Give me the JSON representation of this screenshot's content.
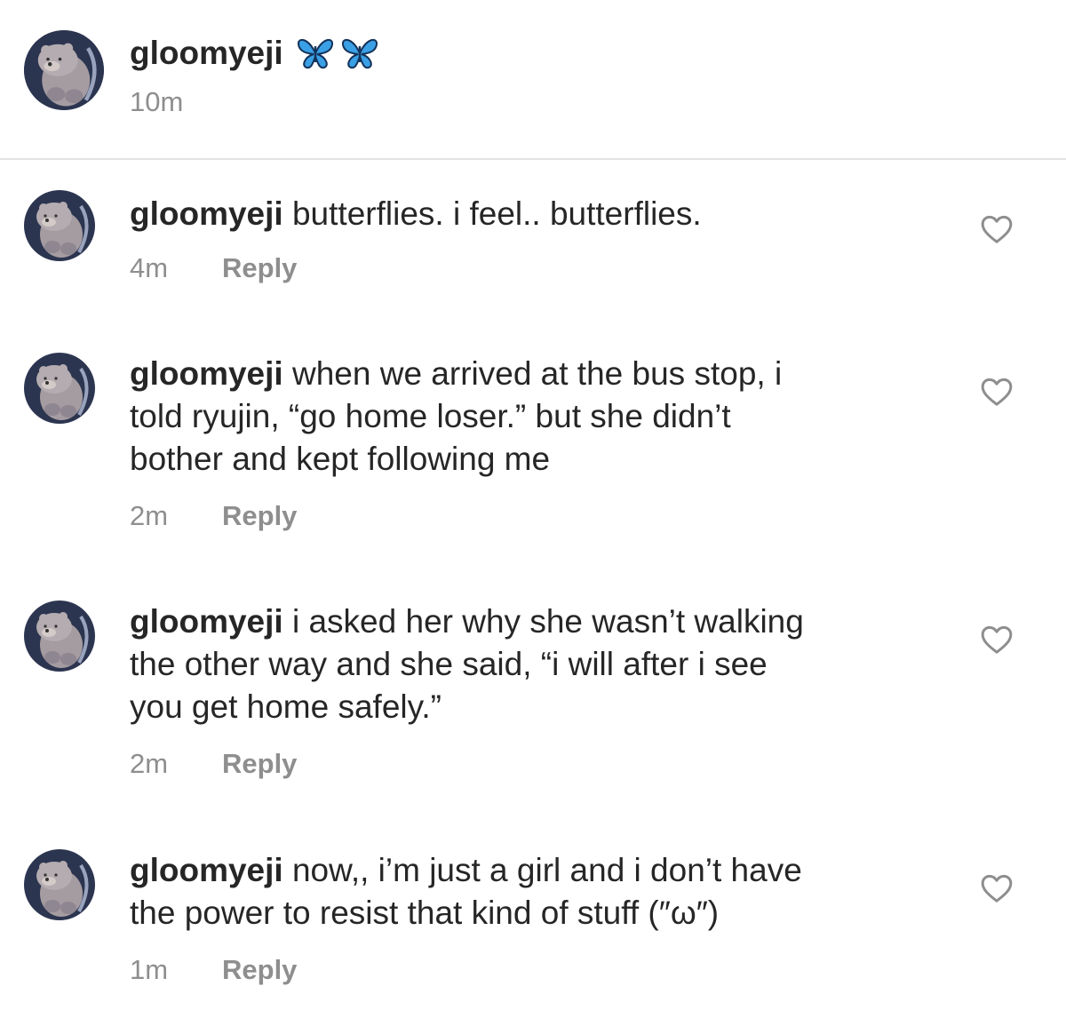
{
  "post": {
    "username": "gloomyeji",
    "emoji": [
      "butterfly",
      "butterfly"
    ],
    "time": "10m"
  },
  "comments": [
    {
      "username": "gloomyeji",
      "text": "butterflies. i feel.. butterflies.",
      "time": "4m",
      "reply_label": "Reply"
    },
    {
      "username": "gloomyeji",
      "text": "when we arrived at the bus stop, i\ntold ryujin, “go home loser.” but she didn’t\nbother and kept following me",
      "time": "2m",
      "reply_label": "Reply"
    },
    {
      "username": "gloomyeji",
      "text": "i asked her why she wasn’t walking\nthe other way and she said, “i will after i see\nyou get home safely.”",
      "time": "2m",
      "reply_label": "Reply"
    },
    {
      "username": "gloomyeji",
      "text": "now,, i’m just a girl and i don’t have\nthe power to resist that kind of stuff (″ω″)",
      "time": "1m",
      "reply_label": "Reply"
    }
  ],
  "colors": {
    "text": "#262626",
    "secondary": "#8e8e8e",
    "divider": "#e2e2e2",
    "butterfly": "#3aa0e6"
  },
  "icons": {
    "heart": "heart-outline-icon",
    "avatar": "bear-avatar",
    "emoji": "butterfly-emoji"
  }
}
